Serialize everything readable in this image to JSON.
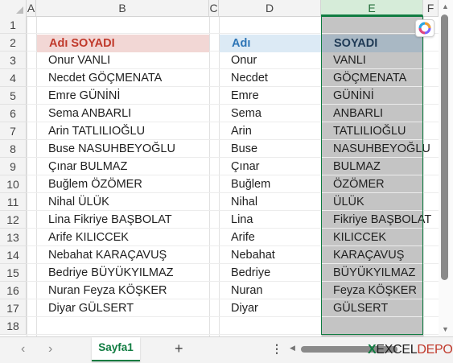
{
  "columns": [
    "A",
    "B",
    "C",
    "D",
    "E",
    "F"
  ],
  "rows": [
    "1",
    "2",
    "3",
    "4",
    "5",
    "6",
    "7",
    "8",
    "9",
    "10",
    "11",
    "12",
    "13",
    "14",
    "15",
    "16",
    "17",
    "18"
  ],
  "headers": {
    "b": "Adı SOYADI",
    "d": "Adı",
    "e": "SOYADI"
  },
  "data": [
    {
      "full": "Onur VANLI",
      "first": "Onur",
      "last": "VANLI"
    },
    {
      "full": "Necdet GÖÇMENATA",
      "first": "Necdet",
      "last": "GÖÇMENATA"
    },
    {
      "full": "Emre GÜNİNİ",
      "first": "Emre",
      "last": "GÜNİNİ"
    },
    {
      "full": "Sema ANBARLI",
      "first": "Sema",
      "last": "ANBARLI"
    },
    {
      "full": "Arin TATLILIOĞLU",
      "first": "Arin",
      "last": "TATLILIOĞLU"
    },
    {
      "full": "Buse NASUHBEYOĞLU",
      "first": "Buse",
      "last": "NASUHBEYOĞLU"
    },
    {
      "full": "Çınar BULMAZ",
      "first": "Çınar",
      "last": "BULMAZ"
    },
    {
      "full": "Buğlem ÖZÖMER",
      "first": "Buğlem",
      "last": "ÖZÖMER"
    },
    {
      "full": "Nihal ÜLÜK",
      "first": "Nihal",
      "last": "ÜLÜK"
    },
    {
      "full": "Lina Fikriye BAŞBOLAT",
      "first": "Lina",
      "last": "Fikriye BAŞBOLAT"
    },
    {
      "full": "Arife KILICCEK",
      "first": "Arife",
      "last": "KILICCEK"
    },
    {
      "full": "Nebahat KARAÇAVUŞ",
      "first": "Nebahat",
      "last": "KARAÇAVUŞ"
    },
    {
      "full": "Bedriye BÜYÜKYILMAZ",
      "first": "Bedriye",
      "last": "BÜYÜKYILMAZ"
    },
    {
      "full": "Nuran Feyza KÖŞKER",
      "first": "Nuran",
      "last": "Feyza KÖŞKER"
    },
    {
      "full": "Diyar GÜLSERT",
      "first": "Diyar",
      "last": "GÜLSERT"
    }
  ],
  "sheet_tab": "Sayfa1",
  "add_sheet": "+",
  "more": "⋮",
  "brand": {
    "x": "X",
    "excel": "EXCEL",
    "depo": "DEPO"
  },
  "colors": {
    "header_b_bg": "#f2d7d5",
    "header_b_text": "#c0392b",
    "header_d_bg": "#dceaf5",
    "header_d_text": "#2e75b6",
    "header_e_bg": "#a9b8c4",
    "header_e_text": "#1f3a55",
    "selection": "#107c41"
  }
}
